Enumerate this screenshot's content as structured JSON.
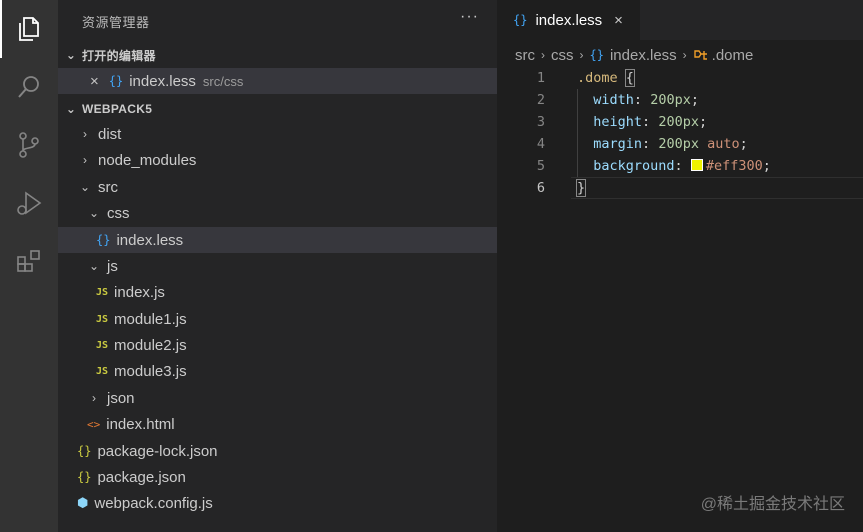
{
  "sidebar": {
    "title": "资源管理器",
    "more": "···",
    "open_editors": {
      "heading": "打开的编辑器",
      "items": [
        {
          "name": "index.less",
          "path": "src/css",
          "close": "×"
        }
      ]
    },
    "project": {
      "heading": "WEBPACK5",
      "tree": [
        {
          "name": "dist",
          "chev": "›"
        },
        {
          "name": "node_modules",
          "chev": "›"
        },
        {
          "name": "src",
          "chev": "⌄"
        },
        {
          "name": "css",
          "chev": "⌄"
        },
        {
          "name": "index.less",
          "icon": "{}"
        },
        {
          "name": "js",
          "chev": "⌄"
        },
        {
          "name": "index.js",
          "icon": "JS"
        },
        {
          "name": "module1.js",
          "icon": "JS"
        },
        {
          "name": "module2.js",
          "icon": "JS"
        },
        {
          "name": "module3.js",
          "icon": "JS"
        },
        {
          "name": "json",
          "chev": "›"
        },
        {
          "name": "index.html",
          "icon": "<>"
        },
        {
          "name": "package-lock.json",
          "icon": "{}"
        },
        {
          "name": "package.json",
          "icon": "{}"
        },
        {
          "name": "webpack.config.js",
          "icon": "⬢"
        }
      ]
    }
  },
  "editor": {
    "tab": {
      "label": "index.less",
      "icon": "{}",
      "close": "×"
    },
    "breadcrumb": {
      "p1": "src",
      "p2": "css",
      "p3": "index.less",
      "p4": ".dome",
      "sep": "›",
      "icon": "{}"
    },
    "lines": [
      {
        "n": "1",
        "selector": ".dome",
        "brace": "{"
      },
      {
        "n": "2",
        "prop": "width",
        "value": "200px"
      },
      {
        "n": "3",
        "prop": "height",
        "value": "200px"
      },
      {
        "n": "4",
        "prop": "margin",
        "value": "200px",
        "value2": "auto"
      },
      {
        "n": "5",
        "prop": "background",
        "color": "#eff300"
      },
      {
        "n": "6",
        "brace": "}"
      }
    ],
    "colon": ":",
    "semi": ";"
  },
  "watermark": "@稀土掘金技术社区",
  "colors": {
    "swatch": "#eff300",
    "accent": "#42a5f5"
  }
}
